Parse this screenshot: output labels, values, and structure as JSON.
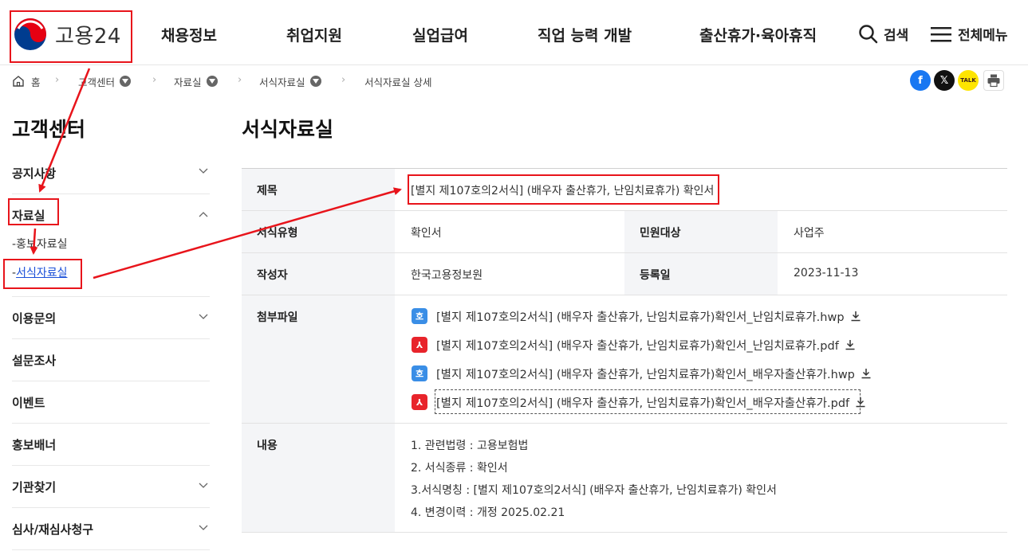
{
  "header": {
    "logo_text": "고용24",
    "nav": [
      "채용정보",
      "취업지원",
      "실업급여",
      "직업 능력 개발",
      "출산휴가·육아휴직"
    ],
    "search_label": "검색",
    "menu_label": "전체메뉴"
  },
  "breadcrumb": {
    "home": "홈",
    "items": [
      "고객센터",
      "자료실",
      "서식자료실"
    ],
    "current": "서식자료실 상세"
  },
  "share": {
    "facebook_icon": "f",
    "x_icon": "𝕏",
    "kakao_icon": "TALK"
  },
  "sidebar": {
    "title": "고객센터",
    "items": {
      "notice": "공지사항",
      "archive": "자료실",
      "promo": "홍보자료실",
      "forms": "서식자료실",
      "inquiry": "이용문의",
      "survey": "설문조사",
      "event": "이벤트",
      "banner": "홍보배너",
      "agency": "기관찾기",
      "appeal": "심사/재심사청구"
    },
    "sub_prefix": "-"
  },
  "main": {
    "title": "서식자료실",
    "labels": {
      "subject": "제목",
      "form_type": "서식유형",
      "target": "민원대상",
      "author": "작성자",
      "reg_date": "등록일",
      "attachments": "첨부파일",
      "content": "내용"
    },
    "subject": "[별지 제107호의2서식] (배우자 출산휴가, 난임치료휴가) 확인서",
    "form_type": "확인서",
    "target": "사업주",
    "author": "한국고용정보원",
    "reg_date": "2023-11-13",
    "files": [
      {
        "type": "hwp",
        "icon": "호",
        "name": "[별지 제107호의2서식] (배우자 출산휴가, 난임치료휴가)확인서_난임치료휴가.hwp"
      },
      {
        "type": "pdf",
        "icon": "⅄",
        "name": "[별지 제107호의2서식] (배우자 출산휴가, 난임치료휴가)확인서_난임치료휴가.pdf"
      },
      {
        "type": "hwp",
        "icon": "호",
        "name": "[별지 제107호의2서식] (배우자 출산휴가, 난임치료휴가)확인서_배우자출산휴가.hwp"
      },
      {
        "type": "pdf",
        "icon": "⅄",
        "name": "[별지 제107호의2서식] (배우자 출산휴가, 난임치료휴가)확인서_배우자출산휴가.pdf"
      }
    ],
    "content_lines": [
      "1. 관련법령 : 고용보험법",
      "2. 서식종류 : 확인서",
      "3.서식명칭 : [별지 제107호의2서식] (배우자 출산휴가, 난임치료휴가) 확인서",
      "4. 변경이력 : 개정 2025.02.21"
    ]
  },
  "colors": {
    "annotation": "#e8141b",
    "link_active": "#1a4fd8",
    "hwp_icon": "#3a8ee6",
    "pdf_icon": "#e8242b",
    "facebook": "#1877f2",
    "kakao": "#fee500"
  }
}
